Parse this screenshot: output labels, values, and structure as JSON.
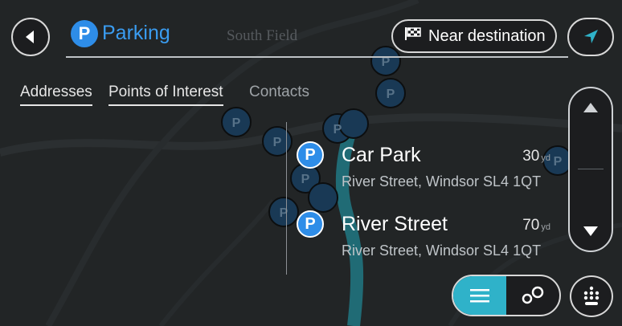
{
  "search": {
    "query": "Parking",
    "badge": "P"
  },
  "map": {
    "label": "South Field"
  },
  "filter": {
    "label": "Near destination"
  },
  "tabs": [
    {
      "label": "Addresses",
      "active": true
    },
    {
      "label": "Points of Interest",
      "active": true
    },
    {
      "label": "Contacts",
      "active": false
    }
  ],
  "results": [
    {
      "badge": "P",
      "name": "Car Park",
      "address": "River Street, Windsor SL4 1QT",
      "distance": "30",
      "unit": "yd"
    },
    {
      "badge": "P",
      "name": "River Street",
      "address": "River Street, Windsor SL4 1QT",
      "distance": "70",
      "unit": "yd"
    }
  ],
  "colors": {
    "accent": "#2e8de8",
    "toggle_active": "#2fb2c9",
    "background": "#2a2c2e"
  },
  "icons": {
    "back": "back-arrow-icon",
    "navigate": "navigation-arrow-icon",
    "flag": "checkered-flag-icon",
    "scroll_up": "chevron-up-icon",
    "scroll_down": "chevron-down-icon",
    "list_view": "list-icon",
    "map_view": "map-pins-icon",
    "keyboard": "keyboard-icon"
  }
}
